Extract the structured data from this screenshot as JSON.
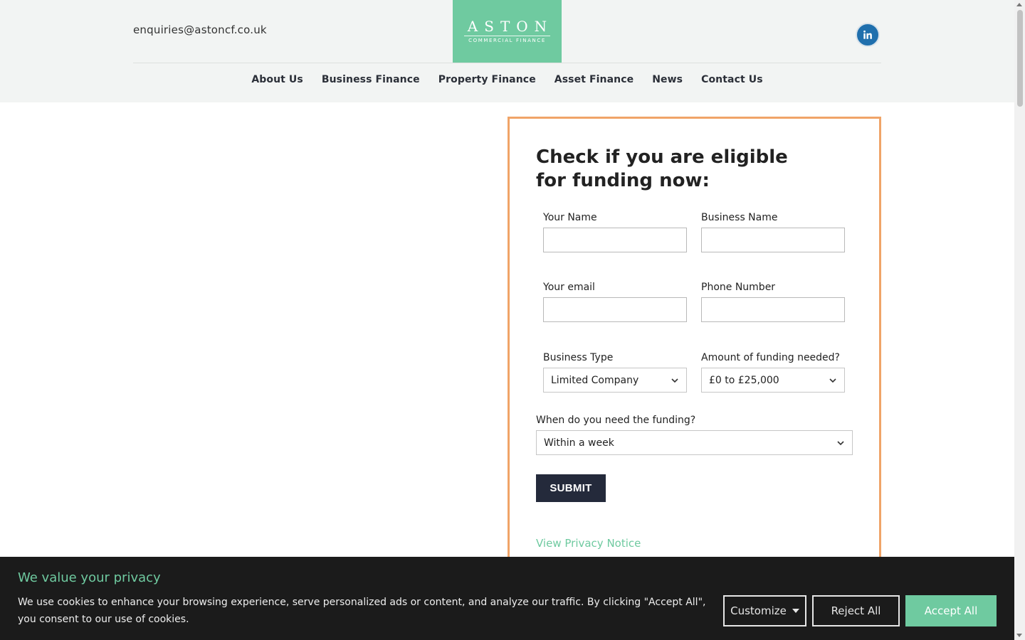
{
  "header": {
    "email": "enquiries@astoncf.co.uk",
    "logo": {
      "main": "ASTON",
      "sub": "COMMERCIAL FINANCE"
    },
    "social_icon": "linkedin-icon"
  },
  "nav": {
    "items": [
      {
        "label": "About Us"
      },
      {
        "label": "Business Finance"
      },
      {
        "label": "Property Finance"
      },
      {
        "label": "Asset Finance"
      },
      {
        "label": "News"
      },
      {
        "label": "Contact Us"
      }
    ]
  },
  "form": {
    "title": "Check if you are eligible for funding now:",
    "your_name": {
      "label": "Your Name",
      "value": ""
    },
    "business_name": {
      "label": "Business Name",
      "value": ""
    },
    "your_email": {
      "label": "Your email",
      "value": ""
    },
    "phone_number": {
      "label": "Phone Number",
      "value": ""
    },
    "business_type": {
      "label": "Business Type",
      "value": "Limited Company"
    },
    "funding_amount": {
      "label": "Amount of funding needed?",
      "value": "£0 to £25,000"
    },
    "funding_when": {
      "label": "When do you need the funding?",
      "value": "Within a week"
    },
    "submit_label": "SUBMIT",
    "privacy_link": "View Privacy Notice"
  },
  "cookie": {
    "title": "We value your privacy",
    "text": "We use cookies to enhance your browsing experience, serve personalized ads or content, and analyze our traffic. By clicking \"Accept All\", you consent to our use of cookies.",
    "customize_label": "Customize",
    "reject_label": "Reject All",
    "accept_label": "Accept All"
  },
  "colors": {
    "accent_green": "#6fcaa0",
    "form_border": "#f0a468",
    "button_dark": "#242a3b",
    "linkedin_blue": "#1f6fad"
  }
}
